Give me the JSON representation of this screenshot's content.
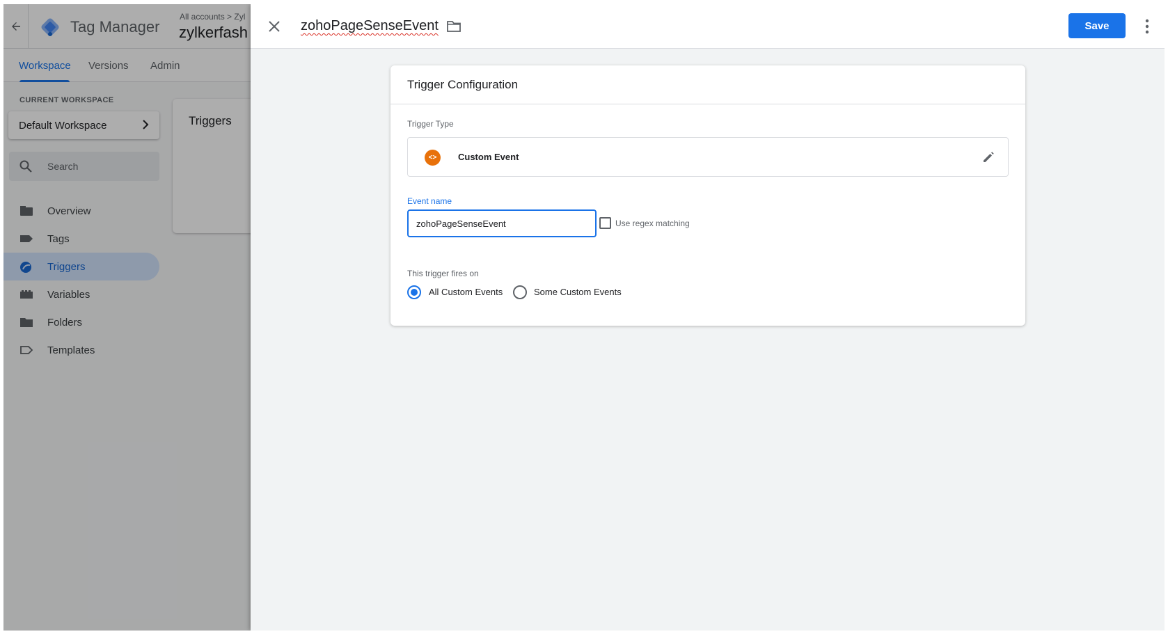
{
  "app": {
    "product_name": "Tag Manager",
    "breadcrumb": "All accounts > Zyl",
    "container_name": "zylkerfash"
  },
  "tabs": [
    {
      "label": "Workspace",
      "active": true
    },
    {
      "label": "Versions",
      "active": false
    },
    {
      "label": "Admin",
      "active": false
    }
  ],
  "sidebar": {
    "workspace_label": "CURRENT WORKSPACE",
    "workspace_name": "Default Workspace",
    "search_placeholder": "Search",
    "items": [
      {
        "label": "Overview",
        "icon": "overview-icon"
      },
      {
        "label": "Tags",
        "icon": "tag-icon"
      },
      {
        "label": "Triggers",
        "icon": "trigger-icon",
        "active": true
      },
      {
        "label": "Variables",
        "icon": "variables-icon"
      },
      {
        "label": "Folders",
        "icon": "folder-icon"
      },
      {
        "label": "Templates",
        "icon": "template-icon"
      }
    ]
  },
  "main": {
    "card_title": "Triggers"
  },
  "sheet": {
    "title": "zohoPageSenseEvent",
    "save_label": "Save",
    "config": {
      "title": "Trigger Configuration",
      "type_label": "Trigger Type",
      "type_name": "Custom Event",
      "type_icon_glyph": "<>",
      "event_name_label": "Event name",
      "event_name_value": "zohoPageSenseEvent",
      "regex_label": "Use regex matching",
      "regex_checked": false,
      "fires_on_label": "This trigger fires on",
      "options": [
        {
          "label": "All Custom Events",
          "checked": true
        },
        {
          "label": "Some Custom Events",
          "checked": false
        }
      ]
    }
  },
  "colors": {
    "accent": "#1a73e8",
    "custom_event_icon": "#e8710a",
    "active_nav_bg": "#d2e3fc"
  }
}
